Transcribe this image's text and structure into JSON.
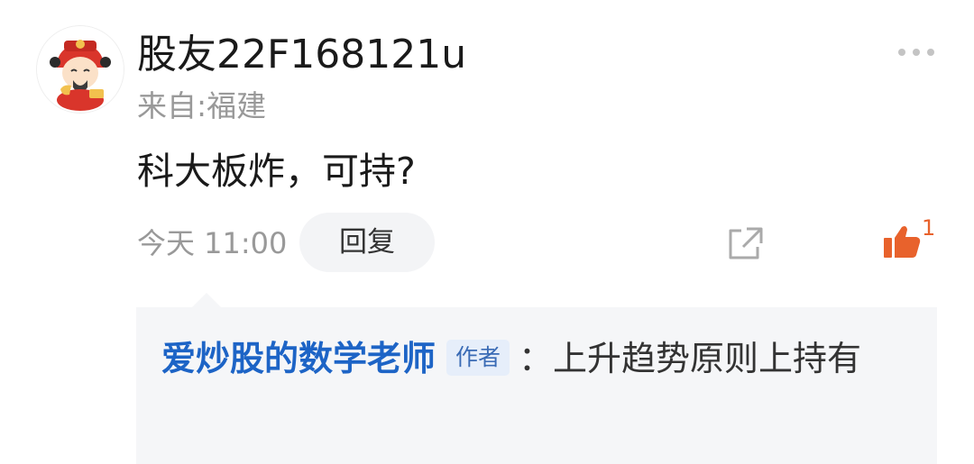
{
  "comment": {
    "avatar_icon": "fortune-god-avatar-icon",
    "username": "股友22F168121u",
    "location": "来自:福建",
    "text": "科大板炸，可持?",
    "timestamp": "今天 11:00",
    "reply_label": "回复",
    "share_icon": "share-external-icon",
    "more_icon": "more-dots-icon",
    "like_icon": "thumbs-up-icon",
    "like_count": "1"
  },
  "reply": {
    "author": "爱炒股的数学老师",
    "badge": "作者",
    "text": "：上升趋势原则上持有"
  },
  "colors": {
    "reply_author": "#1d64c6",
    "like_accent": "#e8622c",
    "reply_background": "#f5f6f8",
    "muted_text": "#999999"
  }
}
